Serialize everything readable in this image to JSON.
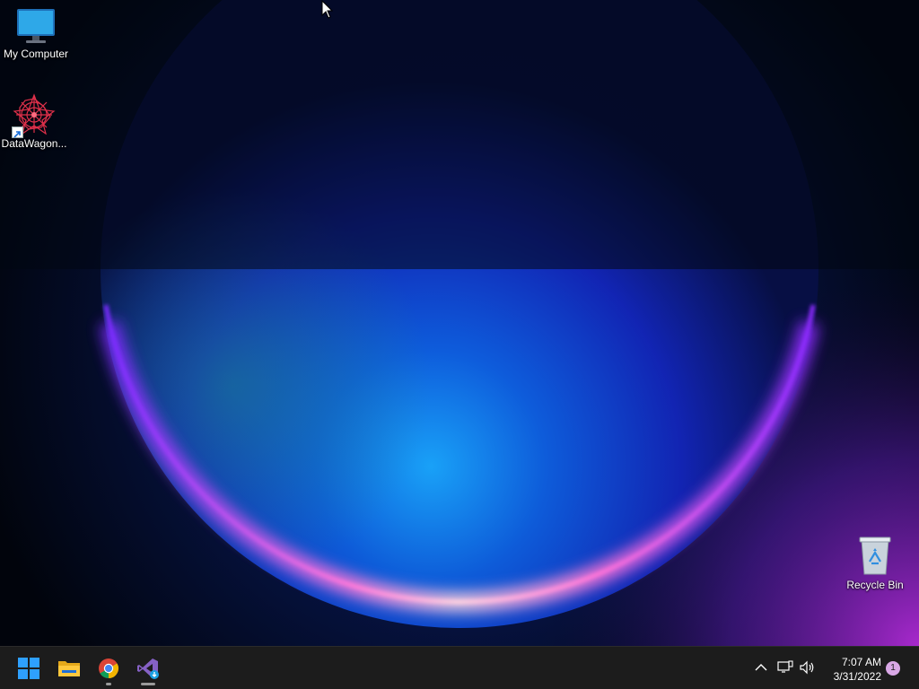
{
  "desktop": {
    "icons": [
      {
        "label": "My Computer",
        "icon": "monitor-icon"
      },
      {
        "label": "DataWagon...",
        "icon": "datawagon-app-icon"
      },
      {
        "label": "Recycle Bin",
        "icon": "recycle-bin-icon"
      }
    ]
  },
  "taskbar": {
    "pinned": [
      {
        "name": "Start",
        "icon": "windows-start-icon"
      },
      {
        "name": "File Explorer",
        "icon": "folder-icon"
      },
      {
        "name": "Google Chrome",
        "icon": "chrome-icon"
      },
      {
        "name": "Visual Studio Installer",
        "icon": "visual-studio-icon"
      }
    ],
    "tray": {
      "icons": [
        "chevron-up-icon",
        "network-icon",
        "volume-icon"
      ],
      "time": "7:07 AM",
      "date": "3/31/2022",
      "notification_count": "1"
    }
  },
  "colors": {
    "taskbar_bg": "#1c1c1c",
    "accent": "#0a84ff",
    "notification_badge": "#d9a8e6"
  }
}
